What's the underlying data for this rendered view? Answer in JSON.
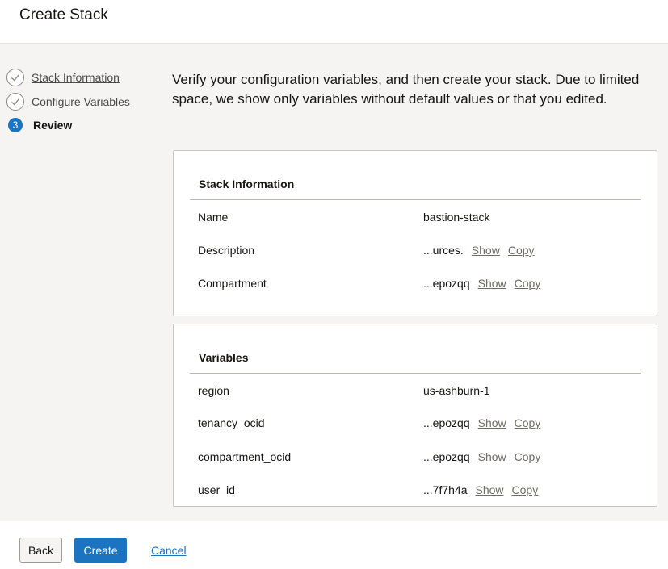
{
  "header": {
    "title": "Create Stack"
  },
  "steps": [
    {
      "label": "Stack Information",
      "state": "complete"
    },
    {
      "label": "Configure Variables",
      "state": "complete"
    },
    {
      "label": "Review",
      "state": "current",
      "number": "3"
    }
  ],
  "intro": "Verify your configuration variables, and then create your stack. Due to limited space, we show only variables without default values or that you edited.",
  "stack_info": {
    "title": "Stack Information",
    "rows": [
      {
        "key": "Name",
        "value": "bastion-stack"
      },
      {
        "key": "Description",
        "value": "...urces.",
        "show": "Show",
        "copy": "Copy"
      },
      {
        "key": "Compartment",
        "value": "...epozqq",
        "show": "Show",
        "copy": "Copy"
      }
    ]
  },
  "variables": {
    "title": "Variables",
    "rows": [
      {
        "key": "region",
        "value": "us-ashburn-1"
      },
      {
        "key": "tenancy_ocid",
        "value": "...epozqq",
        "show": "Show",
        "copy": "Copy"
      },
      {
        "key": "compartment_ocid",
        "value": "...epozqq",
        "show": "Show",
        "copy": "Copy"
      },
      {
        "key": "user_id",
        "value": "...7f7h4a",
        "show": "Show",
        "copy": "Copy"
      }
    ]
  },
  "footer": {
    "back": "Back",
    "create": "Create",
    "cancel": "Cancel"
  },
  "colors": {
    "accent": "#1c74c0",
    "panel_bg": "#f5f4f2"
  },
  "icons": {
    "complete": "check-circle-icon"
  }
}
